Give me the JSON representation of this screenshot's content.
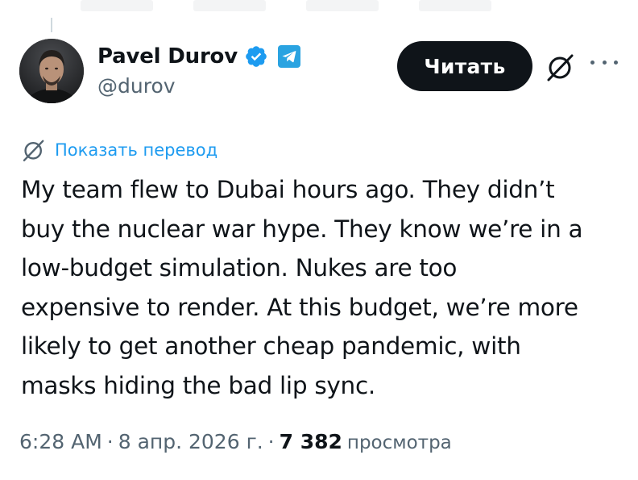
{
  "author": {
    "name": "Pavel Durov",
    "handle": "@durov",
    "verified_color": "#1d9bf0",
    "telegram_color": "#2aa3e1"
  },
  "actions": {
    "read_button_label": "Читать",
    "grok_icon": "grok-icon",
    "more_icon": "more-icon"
  },
  "translate": {
    "label": "Показать перевод"
  },
  "tweet": {
    "lines": [
      "My team flew to Dubai hours ago. They didn’t",
      "buy the nuclear war hype. They know we’re in a",
      "low-budget simulation. Nukes are too",
      "expensive to render. At this budget, we’re more",
      "likely to get another cheap pandemic, with",
      "masks hiding the bad lip sync."
    ]
  },
  "meta": {
    "time": "6:28 AM",
    "separator": "·",
    "date": "8 апр. 2026 г.",
    "views_count": "7 382",
    "views_label": "просмотра"
  },
  "colors": {
    "accent": "#1d9bf0",
    "text": "#0f1419",
    "secondary": "#536471",
    "button_bg": "#0f1419"
  }
}
